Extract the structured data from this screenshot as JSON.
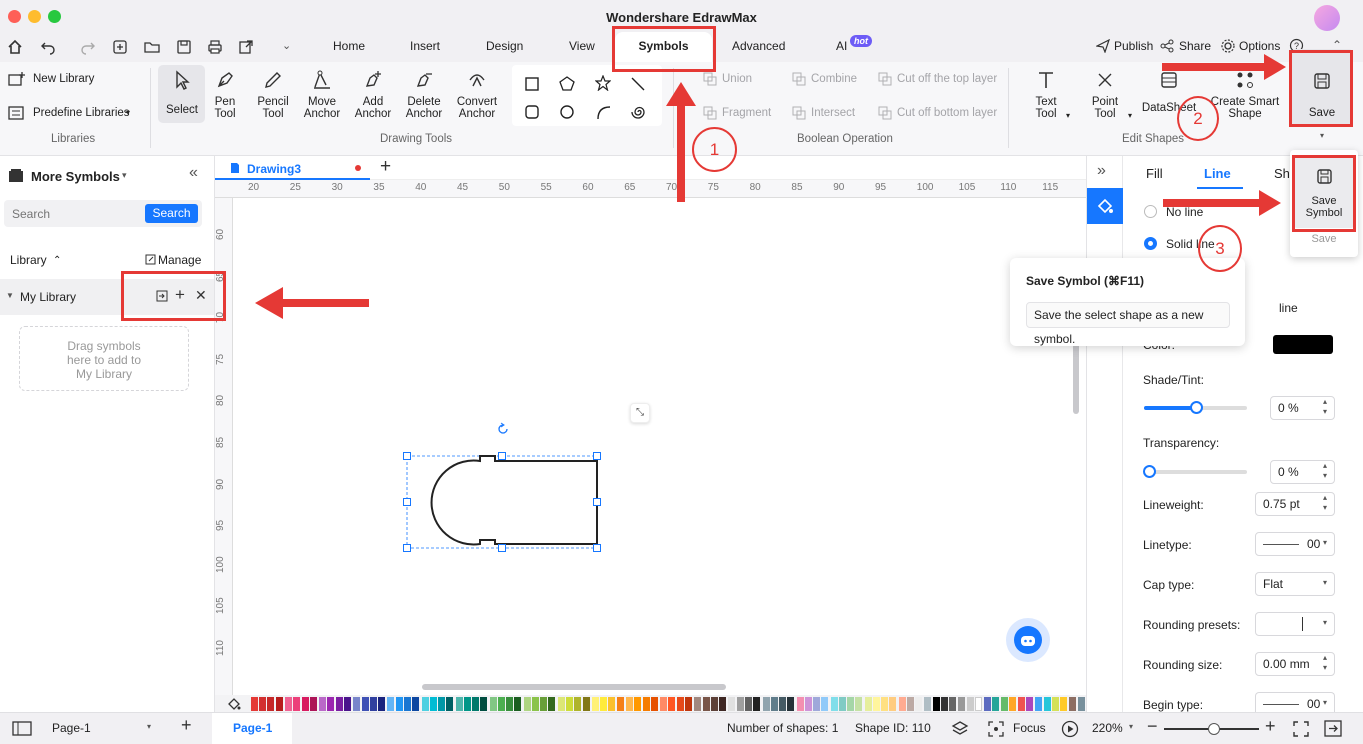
{
  "window": {
    "title": "Wondershare EdrawMax"
  },
  "menu": {
    "tabs": [
      "Home",
      "Insert",
      "Design",
      "View",
      "Symbols",
      "Advanced",
      "AI"
    ],
    "hot_badge": "hot",
    "publish": "Publish",
    "share": "Share",
    "options": "Options"
  },
  "ribbon": {
    "libraries": {
      "new_library": "New Library",
      "predefine": "Predefine Libraries",
      "group": "Libraries"
    },
    "drawing_tools": {
      "select": "Select",
      "pen": [
        "Pen",
        "Tool"
      ],
      "pencil": [
        "Pencil",
        "Tool"
      ],
      "move_anchor": [
        "Move",
        "Anchor"
      ],
      "add_anchor": [
        "Add",
        "Anchor"
      ],
      "delete_anchor": [
        "Delete",
        "Anchor"
      ],
      "convert_anchor": [
        "Convert",
        "Anchor"
      ],
      "group": "Drawing Tools"
    },
    "boolean": {
      "union": "Union",
      "combine": "Combine",
      "cut_top": "Cut off the top layer",
      "fragment": "Fragment",
      "intersect": "Intersect",
      "cut_bottom": "Cut off bottom layer",
      "group": "Boolean Operation"
    },
    "edit_shapes": {
      "text_tool": [
        "Text",
        "Tool"
      ],
      "point_tool": [
        "Point",
        "Tool"
      ],
      "datasheet": "DataSheet",
      "smart_shape": [
        "Create Smart",
        "Shape"
      ],
      "group": "Edit Shapes"
    },
    "save": "Save"
  },
  "save_menu": {
    "save_symbol": [
      "Save",
      "Symbol"
    ],
    "save": "Save"
  },
  "tooltip": {
    "title": "Save Symbol (⌘F11)",
    "body": "Save the select shape as a new symbol."
  },
  "left_panel": {
    "title": "More Symbols",
    "search_placeholder": "Search",
    "search_button": "Search",
    "library_label": "Library",
    "manage": "Manage",
    "my_library": "My Library",
    "drop_hint": [
      "Drag symbols",
      "here to add to",
      "My Library"
    ]
  },
  "document": {
    "tab": "Drawing3"
  },
  "ruler": {
    "top": [
      "20",
      "25",
      "30",
      "35",
      "40",
      "45",
      "50",
      "55",
      "60",
      "65",
      "70",
      "75",
      "80",
      "85",
      "90",
      "95",
      "100",
      "105",
      "110",
      "115"
    ],
    "left": [
      "60",
      "65",
      "70",
      "75",
      "80",
      "85",
      "90",
      "95",
      "100",
      "105",
      "110"
    ]
  },
  "right_panel": {
    "tabs": [
      "Fill",
      "Line",
      "Shado"
    ],
    "no_line": "No line",
    "solid_line": "Solid line",
    "line_partial": "line",
    "color": "Color:",
    "shade_label": "Shade/Tint:",
    "shade_value": "0 %",
    "shade_level": 0.5,
    "transparency_label": "Transparency:",
    "transparency_value": "0 %",
    "transparency_level": 0,
    "lineweight_label": "Lineweight:",
    "lineweight_value": "0.75 pt",
    "linetype_label": "Linetype:",
    "linetype_value": "00",
    "cap_label": "Cap type:",
    "cap_value": "Flat",
    "rounding_presets_label": "Rounding presets:",
    "rounding_size_label": "Rounding size:",
    "rounding_size_value": "0.00 mm",
    "begin_type_label": "Begin type:",
    "begin_type_value": "00"
  },
  "status": {
    "page_select": "Page-1",
    "page_tab": "Page-1",
    "shape_count": "Number of shapes: 1",
    "shape_id": "Shape ID: 110",
    "focus": "Focus",
    "zoom": "220%"
  },
  "annotations": [
    "1",
    "2",
    "3"
  ],
  "colors": {
    "accent": "#1677ff",
    "annotation": "#e53935",
    "panel_bg": "#f7f7f9"
  }
}
